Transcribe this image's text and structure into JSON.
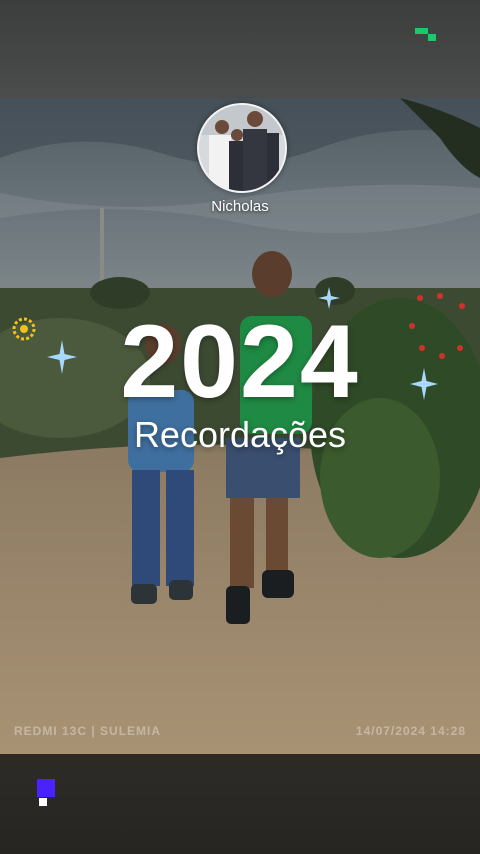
{
  "story": {
    "profile_name": "Nicholas",
    "title_year": "2024",
    "title_subtitle": "Recordações",
    "camera_watermark": "REDMI 13C | SULEMIA",
    "photo_datetime": "14/07/2024  14:28"
  },
  "colors": {
    "accent_green": "#19c96b",
    "pager_blue": "#4a22ff",
    "sparkle_blue": "#a9d8ff",
    "flower_yellow": "#f2c21b"
  },
  "icons": [
    "app-logo-icon",
    "sparkle-icon",
    "flower-icon",
    "story-pager-icon"
  ]
}
